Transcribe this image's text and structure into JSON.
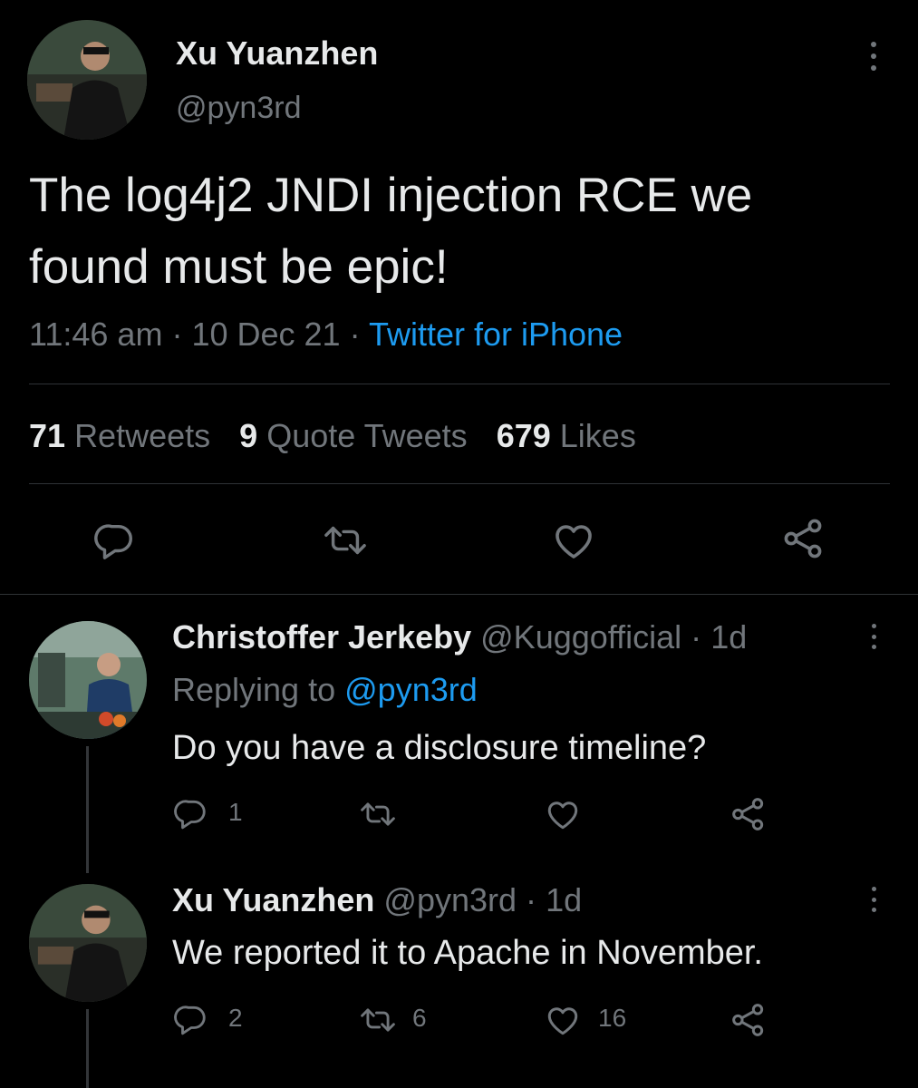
{
  "tweet": {
    "author_name": "Xu Yuanzhen",
    "author_handle": "@pyn3rd",
    "text_line1": "The log4j2 JNDI injection RCE we",
    "text_line2": "found must be epic!",
    "time": "11:46 am",
    "sep1": "·",
    "date": "10 Dec 21",
    "sep2": "·",
    "source": "Twitter for iPhone",
    "stats": {
      "retweets_count": "71",
      "retweets_label": "Retweets",
      "quotes_count": "9",
      "quotes_label": "Quote Tweets",
      "likes_count": "679",
      "likes_label": "Likes"
    },
    "actions": [
      "reply-icon",
      "retweet-icon",
      "like-icon",
      "share-icon"
    ]
  },
  "replies": [
    {
      "author_name": "Christoffer Jerkeby",
      "author_handle": "@Kuggofficial",
      "sep": "·",
      "age": "1d",
      "replying_to_label": "Replying to",
      "replying_to_handle": "@pyn3rd",
      "text": "Do you have a disclosure timeline?",
      "reply_count": "1",
      "retweet_count": "",
      "like_count": ""
    },
    {
      "author_name": "Xu Yuanzhen",
      "author_handle": "@pyn3rd",
      "sep": "·",
      "age": "1d",
      "text": "We reported it to Apache in November.",
      "reply_count": "2",
      "retweet_count": "6",
      "like_count": "16"
    }
  ],
  "colors": {
    "background": "#000000",
    "text": "#e7e9ea",
    "muted": "#71767b",
    "link": "#1d9bf0",
    "divider": "#2f3336"
  }
}
